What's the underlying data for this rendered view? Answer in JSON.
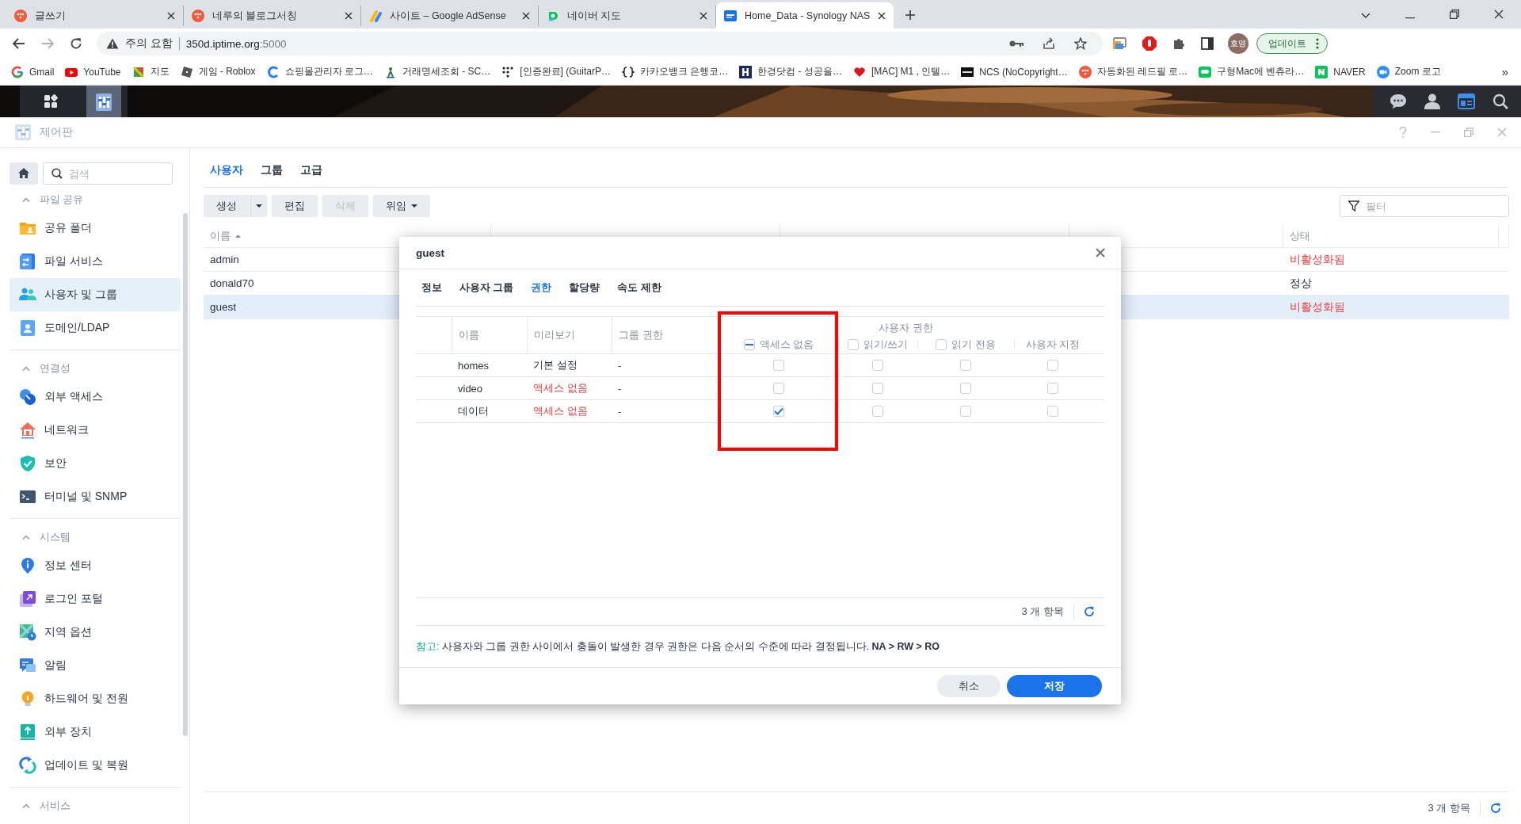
{
  "browser": {
    "tabs": [
      {
        "title": "글쓰기",
        "kind": "tistory",
        "selected": false
      },
      {
        "title": "네루의 블로그서칭",
        "kind": "tistory",
        "selected": false
      },
      {
        "title": "사이트 – Google AdSense",
        "kind": "adsense",
        "selected": false
      },
      {
        "title": "네이버 지도",
        "kind": "map",
        "selected": false
      },
      {
        "title": "Home_Data - Synology NAS",
        "kind": "dsm",
        "selected": true
      }
    ],
    "address": {
      "warning": "주의 요함",
      "host": "350d.iptime.org",
      "port": ":5000"
    },
    "profile": {
      "initials": "호영"
    },
    "update_button": "업데이트",
    "bookmarks": [
      {
        "label": "Gmail",
        "kind": "google"
      },
      {
        "label": "YouTube",
        "kind": "youtube"
      },
      {
        "label": "지도",
        "kind": "maps"
      },
      {
        "label": "게임 - Roblox",
        "kind": "roblox"
      },
      {
        "label": "쇼핑몰관리자 로그…",
        "kind": "cafe"
      },
      {
        "label": "거래명세조회 - SC…",
        "kind": "bank"
      },
      {
        "label": "[인증완료] (GuitarP…",
        "kind": "dots"
      },
      {
        "label": "카카오뱅크 은행코…",
        "kind": "braces"
      },
      {
        "label": "한경닷컴 - 성공을…",
        "kind": "news"
      },
      {
        "label": "[MAC] M1 , 인텔…",
        "kind": "heart"
      },
      {
        "label": "NCS (NoCopyright…",
        "kind": "ncs"
      },
      {
        "label": "자동화된 레드필 로…",
        "kind": "tistory"
      },
      {
        "label": "구형Mac에 벤츄라…",
        "kind": "line"
      },
      {
        "label": "NAVER",
        "kind": "naver"
      },
      {
        "label": "Zoom 로고",
        "kind": "zoom"
      }
    ],
    "bookmarks_more": "»"
  },
  "window": {
    "title": "제어판"
  },
  "sidebar": {
    "search": {
      "placeholder": "검색"
    },
    "sections": [
      {
        "title": "파일 공유",
        "expanded": true,
        "items": [
          {
            "label": "공유 폴더",
            "kind": "folder",
            "selected": false
          },
          {
            "label": "파일 서비스",
            "kind": "fileservice",
            "selected": false
          },
          {
            "label": "사용자 및 그룹",
            "kind": "users",
            "selected": true
          },
          {
            "label": "도메인/LDAP",
            "kind": "domain",
            "selected": false
          }
        ]
      },
      {
        "title": "연결성",
        "expanded": true,
        "items": [
          {
            "label": "외부 액세스",
            "kind": "external",
            "selected": false
          },
          {
            "label": "네트워크",
            "kind": "network",
            "selected": false
          },
          {
            "label": "보안",
            "kind": "security",
            "selected": false
          },
          {
            "label": "터미널 및 SNMP",
            "kind": "terminal",
            "selected": false
          }
        ]
      },
      {
        "title": "시스템",
        "expanded": true,
        "items": [
          {
            "label": "정보 센터",
            "kind": "info",
            "selected": false
          },
          {
            "label": "로그인 포털",
            "kind": "login",
            "selected": false
          },
          {
            "label": "지역 옵션",
            "kind": "region",
            "selected": false
          },
          {
            "label": "알림",
            "kind": "notify",
            "selected": false
          },
          {
            "label": "하드웨어 및 전원",
            "kind": "hardware",
            "selected": false
          },
          {
            "label": "외부 장치",
            "kind": "device",
            "selected": false
          },
          {
            "label": "업데이트 및 복원",
            "kind": "update",
            "selected": false
          }
        ]
      },
      {
        "title": "서비스",
        "expanded": true
      }
    ]
  },
  "tabs": [
    {
      "label": "사용자",
      "selected": true
    },
    {
      "label": "그룹",
      "selected": false
    },
    {
      "label": "고급",
      "selected": false
    }
  ],
  "toolbar": {
    "buttons": [
      {
        "label": "생성",
        "kind": "split",
        "disabled": false
      },
      {
        "label": "편집",
        "kind": "plain",
        "disabled": false
      },
      {
        "label": "삭제",
        "kind": "plain",
        "disabled": true
      },
      {
        "label": "위임",
        "kind": "menu",
        "disabled": false
      }
    ],
    "filter": {
      "placeholder": "필터"
    }
  },
  "table": {
    "columns": [
      {
        "label": "이름",
        "sorted": true
      },
      {
        "label": "상태",
        "sorted": false
      }
    ],
    "rows": [
      {
        "name": "admin",
        "status": "비활성화됨",
        "inactive": true,
        "selected": false
      },
      {
        "name": "donald70",
        "status": "정상",
        "inactive": false,
        "selected": false
      },
      {
        "name": "guest",
        "status": "비활성화됨",
        "inactive": true,
        "selected": true
      }
    ],
    "count": "3 개 항목"
  },
  "dialog": {
    "title": "guest",
    "tabs": [
      {
        "label": "정보",
        "selected": false
      },
      {
        "label": "사용자 그룹",
        "selected": false
      },
      {
        "label": "권한",
        "selected": true
      },
      {
        "label": "할당량",
        "selected": false
      },
      {
        "label": "속도 제한",
        "selected": false
      }
    ],
    "columns": [
      "이름",
      "미리보기",
      "그룹 권한"
    ],
    "user_permissions": {
      "title": "사용자 권한",
      "columns": [
        {
          "label": "액세스 없음",
          "kind": "checkbox",
          "indeterminate": true,
          "highlighted": true
        },
        {
          "label": "읽기/쓰기",
          "kind": "checkbox",
          "indeterminate": false,
          "highlighted": false
        },
        {
          "label": "읽기 전용",
          "kind": "checkbox",
          "indeterminate": false,
          "highlighted": false
        },
        {
          "label": "사용자 지정",
          "kind": "plain",
          "highlighted": false
        }
      ]
    },
    "rows": [
      {
        "name": "homes",
        "preview": "기본 설정",
        "denied": false,
        "group": "-",
        "permissions": [
          {
            "checked": false
          },
          {
            "checked": false
          },
          {
            "checked": false
          },
          {
            "checked": false
          }
        ]
      },
      {
        "name": "video",
        "preview": "액세스 없음",
        "denied": true,
        "group": "-",
        "permissions": [
          {
            "checked": false
          },
          {
            "checked": false
          },
          {
            "checked": false
          },
          {
            "checked": false
          }
        ]
      },
      {
        "name": "데이터",
        "preview": "액세스 없음",
        "denied": true,
        "group": "-",
        "permissions": [
          {
            "checked": true
          },
          {
            "checked": false
          },
          {
            "checked": false
          },
          {
            "checked": false
          }
        ]
      }
    ],
    "count": "3 개 항목",
    "note": {
      "label": "참고:",
      "text": "사용자와 그룹 권한 사이에서 충돌이 발생한 경우 권한은 다음 순서의 수준에 따라 결정됩니다. **NA > RW > RO**"
    },
    "buttons": [
      {
        "label": "취소",
        "kind": "secondary"
      },
      {
        "label": "저장",
        "kind": "primary"
      }
    ]
  }
}
